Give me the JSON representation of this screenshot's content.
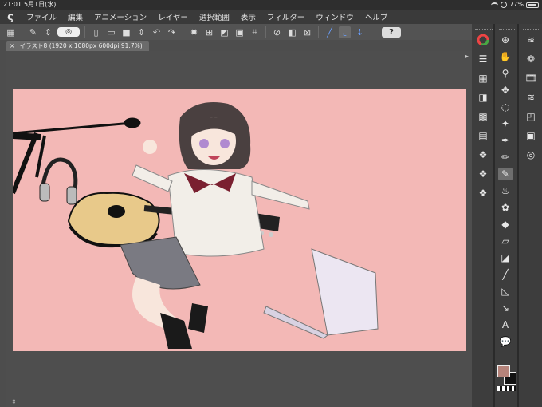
{
  "statusbar": {
    "time": "21:01",
    "date": "5月1日(水)",
    "battery": "77%"
  },
  "menu": {
    "items": [
      "ファイル",
      "編集",
      "アニメーション",
      "レイヤー",
      "選択範囲",
      "表示",
      "フィルター",
      "ウィンドウ",
      "ヘルプ"
    ]
  },
  "toolbar": {
    "help_label": "?"
  },
  "document": {
    "tab_title": "イラスト8 (1920 x 1080px 600dpi 91.7%)",
    "close": "×"
  },
  "colors": {
    "canvas_bg": "#f3b8b6",
    "main_color": "#b5837a",
    "sub_color": "#111111"
  }
}
